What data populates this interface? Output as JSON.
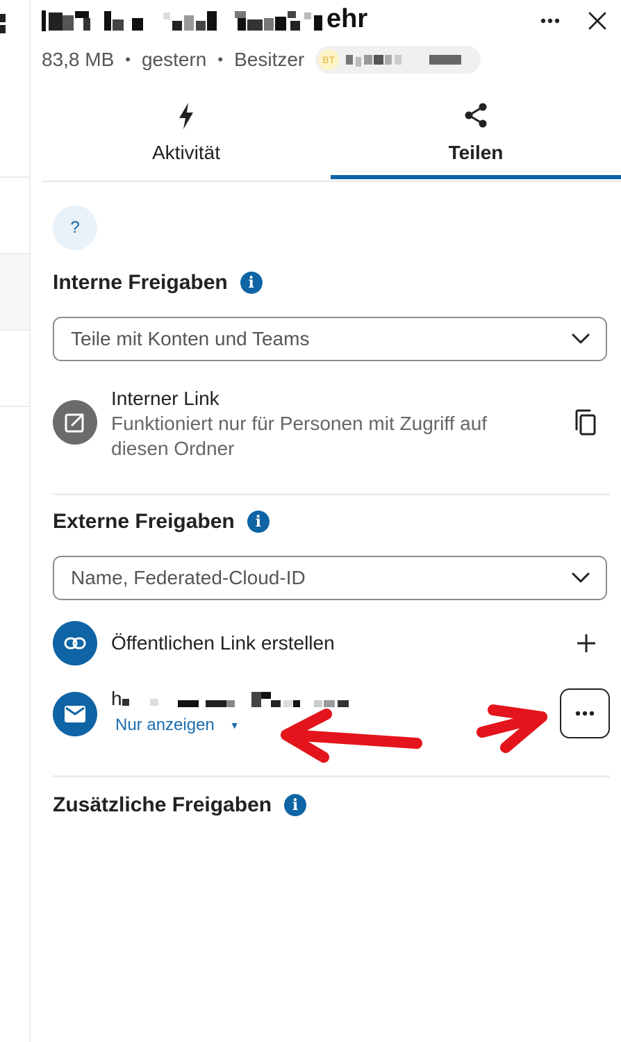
{
  "header": {
    "title_end": "ehr",
    "meta": {
      "size": "83,8 MB",
      "modified": "gestern",
      "owner_label": "Besitzer",
      "owner_initials": "BT"
    }
  },
  "tabs": [
    {
      "label": "Aktivität",
      "icon": "lightning-icon",
      "active": false
    },
    {
      "label": "Teilen",
      "icon": "share-icon",
      "active": true
    }
  ],
  "help": {
    "label": "?"
  },
  "internal": {
    "heading": "Interne Freigaben",
    "info": "i",
    "search_placeholder": "Teile mit Konten und Teams",
    "link_title": "Interner Link",
    "link_desc": "Funktioniert nur für Personen mit Zugriff auf diesen Ordner"
  },
  "external": {
    "heading": "Externe Freigaben",
    "info": "i",
    "search_placeholder": "Name, Federated-Cloud-ID",
    "public_link_label": "Öffentlichen Link erstellen",
    "share_name_initial": "h",
    "share_permission": "Nur anzeigen"
  },
  "additional": {
    "heading": "Zusätzliche Freigaben",
    "info": "i"
  },
  "colors": {
    "accent": "#0e64a5",
    "annotation_arrow": "#e3141b"
  }
}
